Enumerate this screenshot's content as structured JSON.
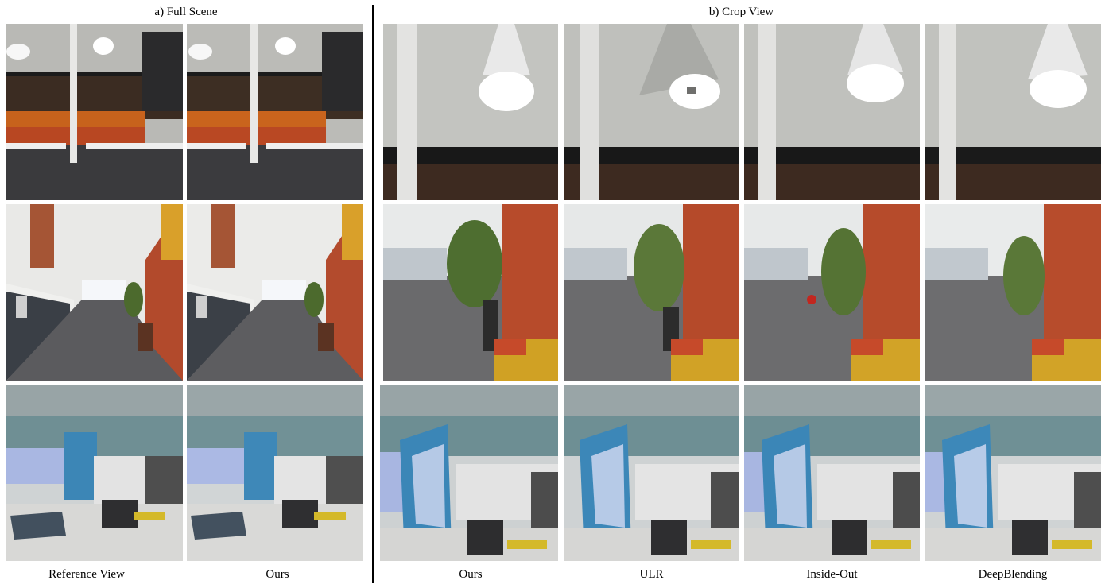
{
  "figure": {
    "left_title": "a) Full Scene",
    "right_title": "b) Crop View",
    "left_columns": [
      "Reference View",
      "Ours"
    ],
    "right_columns": [
      "Ours",
      "ULR",
      "Inside-Out",
      "DeepBlending"
    ]
  },
  "colors": {
    "background": "#ffffff",
    "divider": "#000000"
  }
}
